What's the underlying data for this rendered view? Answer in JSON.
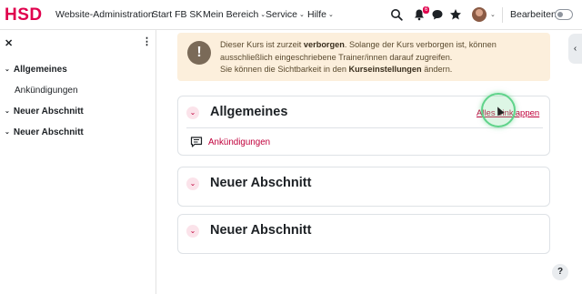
{
  "navbar": {
    "logo": "HSD",
    "menu": [
      {
        "label": "Website-Administration",
        "has_dropdown": false
      },
      {
        "label": "Start FB SK",
        "has_dropdown": false
      },
      {
        "label": "Mein Bereich",
        "has_dropdown": true
      },
      {
        "label": "Service",
        "has_dropdown": true
      },
      {
        "label": "Hilfe",
        "has_dropdown": true
      }
    ],
    "caret": "⌄",
    "icons": [
      "search-icon",
      "bell-icon",
      "chat-icon",
      "star-icon"
    ],
    "notification_count": "6",
    "edit_mode_label": "Bearbeiten",
    "edit_mode_on": false
  },
  "drawer": {
    "close_glyph": "✕",
    "more_glyph": "⋮",
    "items": [
      {
        "label": "Allgemeines",
        "type": "section",
        "expanded": true
      },
      {
        "label": "Ankündigungen",
        "type": "activity"
      },
      {
        "label": "Neuer Abschnitt",
        "type": "section",
        "expanded": true
      },
      {
        "label": "Neuer Abschnitt",
        "type": "section",
        "expanded": true
      }
    ],
    "chevron": "⌄"
  },
  "alert": {
    "icon": "!",
    "line1_pre": "Dieser Kurs ist zurzeit ",
    "line1_bold": "verborgen",
    "line1_post": ". Solange der Kurs verborgen ist, können",
    "line2": "ausschließlich eingeschriebene Trainer/innen darauf zugreifen.",
    "line3_pre": "Sie können die Sichtbarkeit in den ",
    "line3_bold": "Kurseinstellungen",
    "line3_post": " ändern."
  },
  "sections": [
    {
      "title": "Allgemeines",
      "collapse_all_label": "Alles einklappen",
      "activities": [
        {
          "label": "Ankündigungen",
          "icon": "forum-icon"
        }
      ]
    },
    {
      "title": "Neuer Abschnitt",
      "activities": []
    },
    {
      "title": "Neuer Abschnitt",
      "activities": []
    }
  ],
  "section_chevron": "⌄",
  "right_tab_glyph": "‹",
  "help_label": "?",
  "colors": {
    "brand": "#e0004d",
    "link": "#c0003b",
    "alert_bg": "#fcefdc"
  }
}
